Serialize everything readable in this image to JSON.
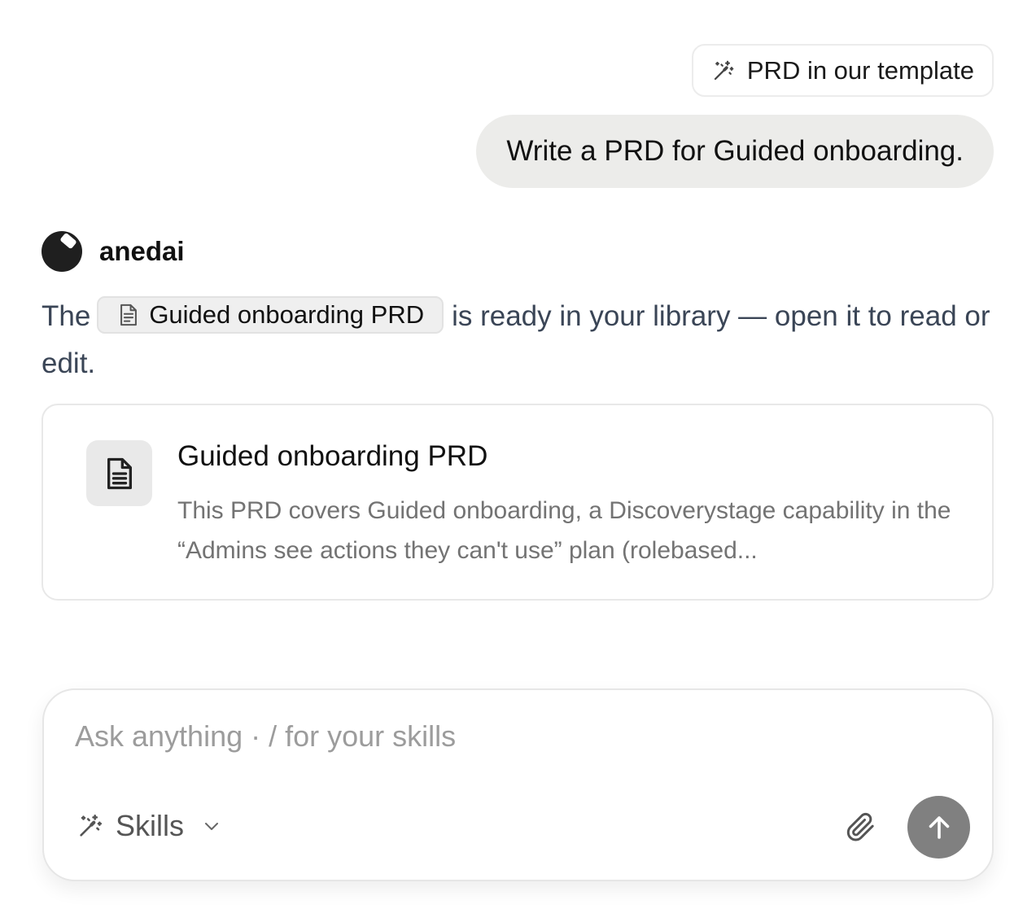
{
  "conversation": {
    "skill_chip": {
      "label": "PRD in our template",
      "icon": "magic-wand-icon"
    },
    "user_message": "Write a PRD for Guided onboarding.",
    "assistant": {
      "name": "anedai",
      "avatar_icon": "anedai-logo-icon",
      "text_before": "The",
      "inline_doc": {
        "label": "Guided onboarding PRD",
        "icon": "document-icon"
      },
      "text_after": "is ready in your library — open it to read or edit."
    },
    "doc_card": {
      "title": "Guided onboarding PRD",
      "description": "This PRD covers Guided onboarding, a Discoverystage capability in the “Admins see actions they can't use” plan (rolebased...",
      "icon": "document-icon"
    }
  },
  "composer": {
    "placeholder": "Ask anything · / for your skills",
    "skills_label": "Skills",
    "skills_icon": "magic-wand-icon",
    "attach_icon": "paperclip-icon",
    "send_icon": "arrow-up-icon",
    "send_color": "#808080"
  }
}
